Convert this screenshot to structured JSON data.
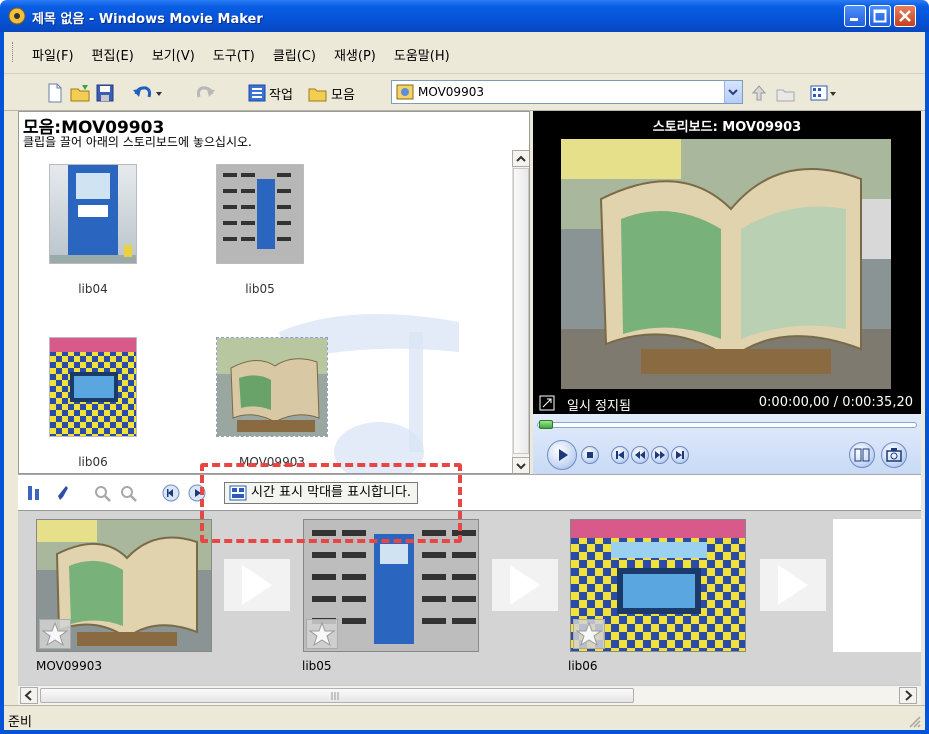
{
  "window": {
    "title": "제목 없음 - Windows Movie Maker"
  },
  "menu": [
    "파일(F)",
    "편집(E)",
    "보기(V)",
    "도구(T)",
    "클립(C)",
    "재생(P)",
    "도움말(H)"
  ],
  "toolbar": {
    "tasks_label": "작업",
    "collections_label": "모음",
    "collection_value": "MOV09903"
  },
  "collection": {
    "heading": "모음:MOV09903",
    "instruction": "클립을 끌어 아래의 스토리보드에 놓으십시오.",
    "clips": [
      "lib04",
      "lib05",
      "lib06",
      "MOV09903"
    ]
  },
  "preview": {
    "title": "스토리보드: MOV09903",
    "status": "일시 정지됨",
    "time": "0:00:00,00 / 0:00:35,20"
  },
  "storyboard_toolbar": {
    "timeline_button_label": "시간 표시 막대를 표시합니다."
  },
  "storyboard": {
    "clips": [
      "MOV09903",
      "lib05",
      "lib06"
    ]
  },
  "statusbar": {
    "text": "준비"
  },
  "colors": {
    "titlebar": "#0553d6",
    "annotation": "#e84545",
    "chrome": "#ece9d8"
  }
}
